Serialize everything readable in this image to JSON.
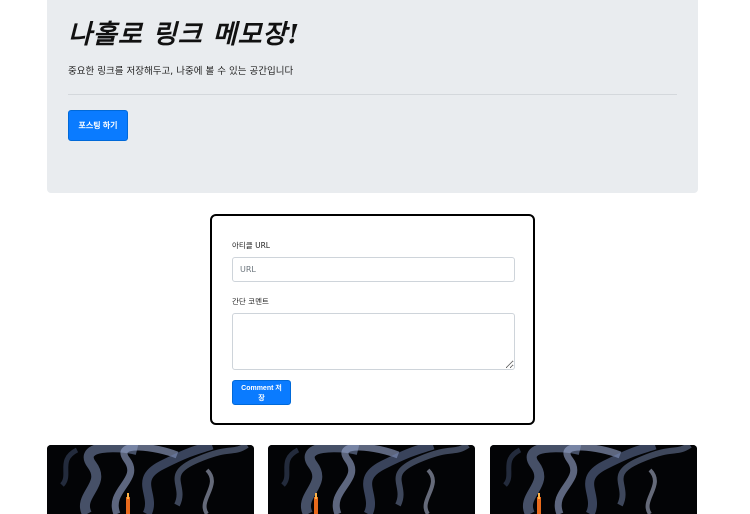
{
  "jumbotron": {
    "title": "나홀로 링크 메모장!",
    "lead": "중요한 링크를 저장해두고, 나중에 볼 수 있는 공간입니다",
    "post_button": "포스팅 하기"
  },
  "form": {
    "url_label": "아티클 URL",
    "url_placeholder": "URL",
    "comment_label": "간단 코멘트",
    "comment_placeholder": "",
    "save_button": "Comment 저장"
  },
  "cards": [
    {
      "image": "smoke-match-image"
    },
    {
      "image": "smoke-match-image"
    },
    {
      "image": "smoke-match-image"
    }
  ]
}
